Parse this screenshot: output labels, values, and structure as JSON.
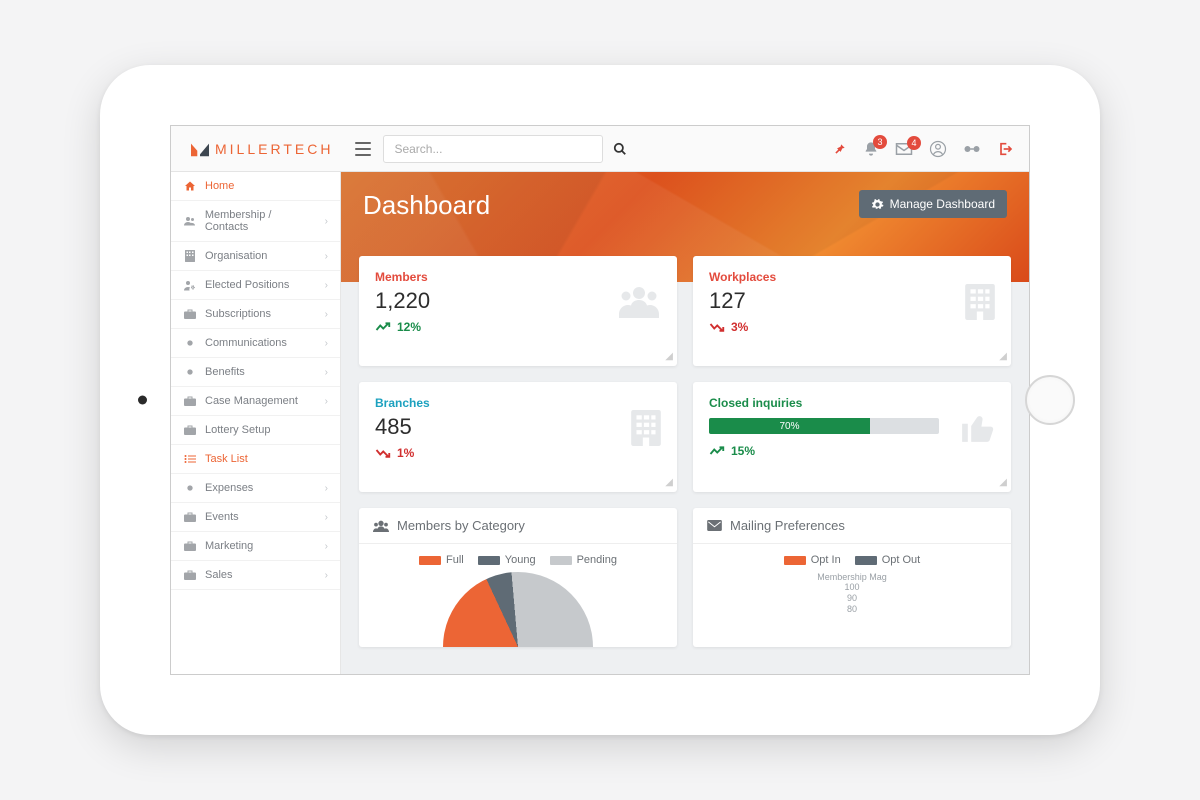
{
  "brand": {
    "name": "MILLERTECH"
  },
  "search": {
    "placeholder": "Search..."
  },
  "notifications": {
    "bell_count": "3",
    "mail_count": "4"
  },
  "sidebar": {
    "items": [
      {
        "label": "Home",
        "icon": "home",
        "active": true,
        "expandable": false
      },
      {
        "label": "Membership / Contacts",
        "icon": "users",
        "expandable": true
      },
      {
        "label": "Organisation",
        "icon": "building",
        "expandable": true
      },
      {
        "label": "Elected Positions",
        "icon": "user-cog",
        "expandable": true
      },
      {
        "label": "Subscriptions",
        "icon": "briefcase",
        "expandable": true
      },
      {
        "label": "Communications",
        "icon": "bullet",
        "expandable": true
      },
      {
        "label": "Benefits",
        "icon": "bullet",
        "expandable": true
      },
      {
        "label": "Case Management",
        "icon": "briefcase",
        "expandable": true
      },
      {
        "label": "Lottery Setup",
        "icon": "briefcase",
        "expandable": false
      },
      {
        "label": "Task List",
        "icon": "list",
        "highlight": true,
        "expandable": false
      },
      {
        "label": "Expenses",
        "icon": "bullet",
        "expandable": true
      },
      {
        "label": "Events",
        "icon": "briefcase",
        "expandable": true
      },
      {
        "label": "Marketing",
        "icon": "briefcase",
        "expandable": true
      },
      {
        "label": "Sales",
        "icon": "briefcase",
        "expandable": true
      }
    ]
  },
  "hero": {
    "title": "Dashboard",
    "manage_label": "Manage Dashboard"
  },
  "cards": {
    "members": {
      "title": "Members",
      "value": "1,220",
      "trend_pct": "12%",
      "trend_dir": "up"
    },
    "workplaces": {
      "title": "Workplaces",
      "value": "127",
      "trend_pct": "3%",
      "trend_dir": "down"
    },
    "branches": {
      "title": "Branches",
      "value": "485",
      "trend_pct": "1%",
      "trend_dir": "down"
    },
    "closed": {
      "title": "Closed inquiries",
      "progress_pct": 70,
      "progress_label": "70%",
      "trend_pct": "15%",
      "trend_dir": "up"
    }
  },
  "panels": {
    "members_by_category": {
      "title": "Members by Category",
      "legend": [
        {
          "label": "Full",
          "color": "#ec6535"
        },
        {
          "label": "Young",
          "color": "#5f6b75"
        },
        {
          "label": "Pending",
          "color": "#c6c9cc"
        }
      ]
    },
    "mailing_prefs": {
      "title": "Mailing Preferences",
      "legend": [
        {
          "label": "Opt In",
          "color": "#ec6535"
        },
        {
          "label": "Opt Out",
          "color": "#5f6b75"
        }
      ],
      "axis_title": "Membership Mag",
      "axis_ticks": [
        "100",
        "90",
        "80"
      ]
    }
  },
  "chart_data": [
    {
      "type": "pie",
      "title": "Members by Category",
      "series": [
        {
          "name": "Full",
          "value": 36,
          "color": "#ec6535"
        },
        {
          "name": "Young",
          "value": 11,
          "color": "#5f6b75"
        },
        {
          "name": "Pending",
          "value": 53,
          "color": "#c6c9cc"
        }
      ]
    },
    {
      "type": "bar",
      "title": "Mailing Preferences",
      "categories": [
        "Membership Mag"
      ],
      "series": [
        {
          "name": "Opt In",
          "color": "#ec6535"
        },
        {
          "name": "Opt Out",
          "color": "#5f6b75"
        }
      ],
      "ylim": [
        0,
        100
      ],
      "yticks": [
        80,
        90,
        100
      ]
    }
  ]
}
